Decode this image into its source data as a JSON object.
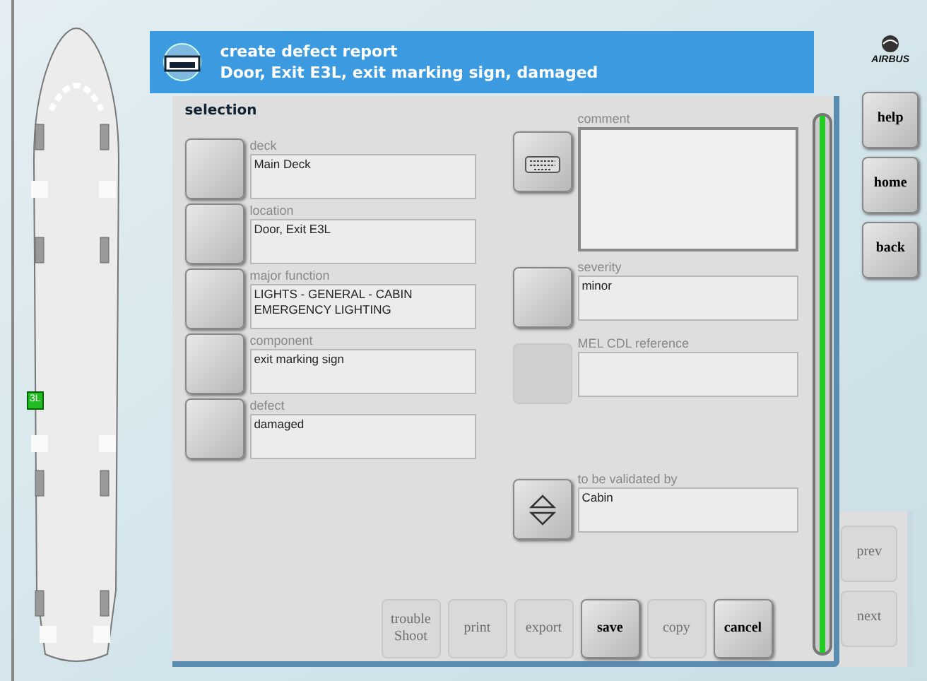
{
  "aircraft": {
    "selected_door": "3L"
  },
  "header": {
    "title": "create defect report",
    "subtitle": "Door, Exit E3L, exit marking sign, damaged"
  },
  "logo": {
    "text": "AIRBUS"
  },
  "panel": {
    "title": "selection"
  },
  "left_fields": [
    {
      "label": "deck",
      "value": "Main Deck"
    },
    {
      "label": "location",
      "value": "Door, Exit E3L"
    },
    {
      "label": "major function",
      "value": "LIGHTS - GENERAL - CABIN EMERGENCY LIGHTING"
    },
    {
      "label": "component",
      "value": "exit marking sign"
    },
    {
      "label": "defect",
      "value": "damaged"
    }
  ],
  "right_fields": [
    {
      "label": "comment",
      "kind": "keyboard",
      "disabled": false
    },
    {
      "label": "severity",
      "kind": "picker",
      "disabled": false,
      "value": "minor"
    },
    {
      "label": "MEL CDL reference",
      "kind": "picker",
      "disabled": true
    },
    {
      "label": "to be validated by",
      "kind": "updown",
      "disabled": false,
      "value": "Cabin"
    }
  ],
  "actions": [
    {
      "label": "trouble Shoot",
      "disabled": true
    },
    {
      "label": "print",
      "disabled": true
    },
    {
      "label": "export",
      "disabled": true
    },
    {
      "label": "save",
      "disabled": false
    },
    {
      "label": "copy",
      "disabled": true
    },
    {
      "label": "cancel",
      "disabled": false
    }
  ],
  "side_buttons": [
    {
      "label": "help",
      "disabled": false
    },
    {
      "label": "home",
      "disabled": false
    },
    {
      "label": "back",
      "disabled": false
    }
  ],
  "paging": [
    {
      "label": "prev",
      "disabled": true
    },
    {
      "label": "next",
      "disabled": true
    }
  ]
}
